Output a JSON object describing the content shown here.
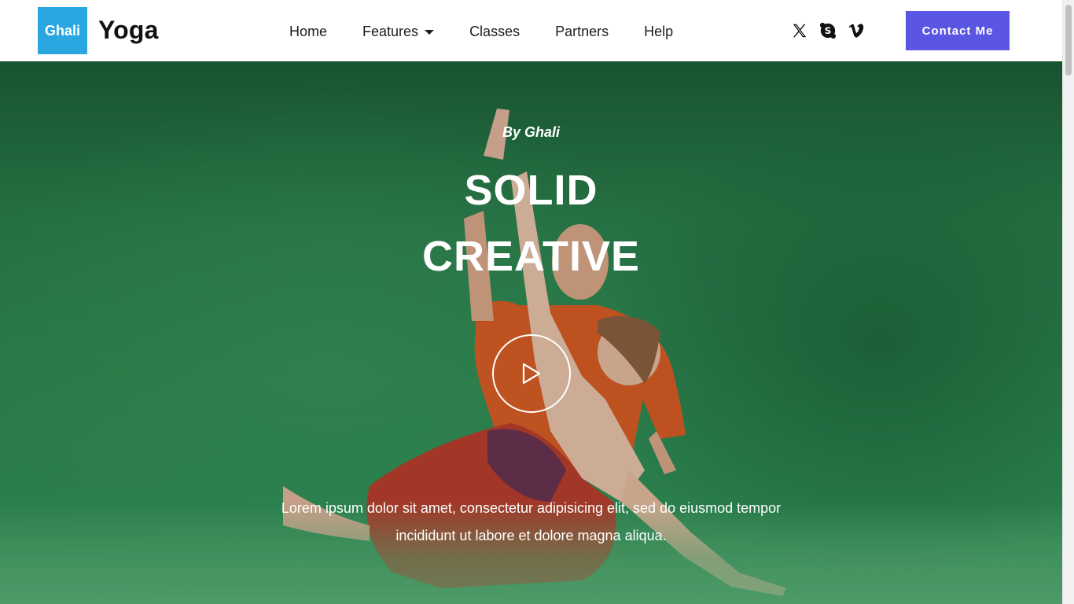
{
  "header": {
    "logo_box": "Ghali",
    "logo_text": "Yoga",
    "nav": [
      {
        "label": "Home"
      },
      {
        "label": "Features"
      },
      {
        "label": "Classes"
      },
      {
        "label": "Partners"
      },
      {
        "label": "Help"
      }
    ],
    "socials": [
      {
        "icon": "x-twitter-icon"
      },
      {
        "icon": "skype-icon"
      },
      {
        "icon": "vimeo-icon"
      }
    ],
    "contact_label": "Contact Me"
  },
  "hero": {
    "byline": "By Ghali",
    "title_line1": "SOLID",
    "title_line2": "CREATIVE",
    "description": "Lorem ipsum dolor sit amet, consectetur adipisicing elit, sed do eiusmod tempor incididunt ut labore et dolore magna aliqua.",
    "play_icon": "play-icon"
  },
  "colors": {
    "logo_box": "#2aa7e0",
    "accent_button": "#5b55e3",
    "hero_green": "#2e8551",
    "text_dark": "#111111"
  }
}
